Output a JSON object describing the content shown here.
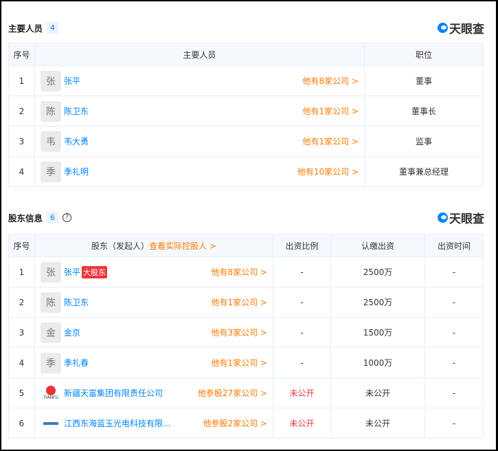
{
  "staff": {
    "title": "主要人员",
    "count": "4",
    "logo": "天眼查",
    "headers": [
      "序号",
      "主要人员",
      "职位"
    ],
    "rows": [
      {
        "no": "1",
        "avatar": "张",
        "name": "张平",
        "more": "他有8家公司 >",
        "role": "董事"
      },
      {
        "no": "2",
        "avatar": "陈",
        "name": "陈卫东",
        "more": "他有1家公司 >",
        "role": "董事长"
      },
      {
        "no": "3",
        "avatar": "韦",
        "name": "韦大勇",
        "more": "他有1家公司 >",
        "role": "监事"
      },
      {
        "no": "4",
        "avatar": "季",
        "name": "季礼明",
        "more": "他有10家公司 >",
        "role": "董事兼总经理"
      }
    ]
  },
  "holders": {
    "title": "股东信息",
    "count": "6",
    "help": "?",
    "logo": "天眼查",
    "headers": [
      "序号",
      "股东（发起人）",
      "查看实际控股人 >",
      "出资比例",
      "认缴出资",
      "出资时间"
    ],
    "rows": [
      {
        "no": "1",
        "avatar": "张",
        "name": "张平",
        "tag": "大股东",
        "more": "他有8家公司 >",
        "ratio": "-",
        "amount": "2500万",
        "time": "-"
      },
      {
        "no": "2",
        "avatar": "陈",
        "name": "陈卫东",
        "more": "他有1家公司 >",
        "ratio": "-",
        "amount": "2500万",
        "time": "-"
      },
      {
        "no": "3",
        "avatar": "金",
        "name": "金京",
        "more": "他有3家公司 >",
        "ratio": "-",
        "amount": "1500万",
        "time": "-"
      },
      {
        "no": "4",
        "avatar": "季",
        "name": "季礼春",
        "more": "他有1家公司 >",
        "ratio": "-",
        "amount": "1000万",
        "time": "-"
      },
      {
        "no": "5",
        "logo_text": "TIANFU",
        "name": "新疆天富集团有限责任公司",
        "more": "他参股27家公司 >",
        "ratio": "未公开",
        "amount": "未公开",
        "time": "-"
      },
      {
        "no": "6",
        "name": "江西东海蓝玉光电科技有限...",
        "more": "他参股2家公司 >",
        "ratio": "未公开",
        "amount": "未公开",
        "time": "-"
      }
    ]
  }
}
